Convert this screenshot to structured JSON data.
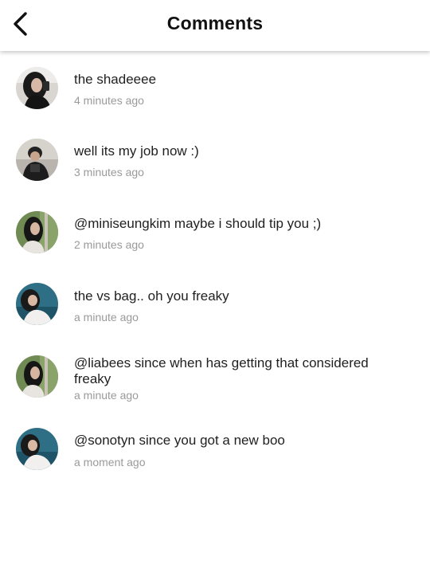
{
  "header": {
    "title": "Comments",
    "back_icon": "chevron-left-icon"
  },
  "comments": [
    {
      "text": "the shadeeee",
      "time": "4 minutes ago",
      "avatar": "avatar-photo-dark-hair-girl"
    },
    {
      "text": "well its my job now :)",
      "time": "3 minutes ago",
      "avatar": "avatar-photo-guy-black-jacket"
    },
    {
      "text": "@miniseungkim maybe i should tip you ;)",
      "time": "2 minutes ago",
      "avatar": "avatar-photo-girl-outdoors"
    },
    {
      "text": "the vs bag.. oh you freaky",
      "time": "a minute ago",
      "avatar": "avatar-photo-girl-blue-background"
    },
    {
      "text": "@liabees since when has getting that considered freaky",
      "time": "a minute ago",
      "avatar": "avatar-photo-girl-outdoors"
    },
    {
      "text": "@sonotyn since you got a new boo",
      "time": "a moment ago",
      "avatar": "avatar-photo-girl-blue-background"
    }
  ],
  "colors": {
    "text": "#1f1f1f",
    "timestamp": "#9a9a9a",
    "header_bg": "#ffffff"
  }
}
